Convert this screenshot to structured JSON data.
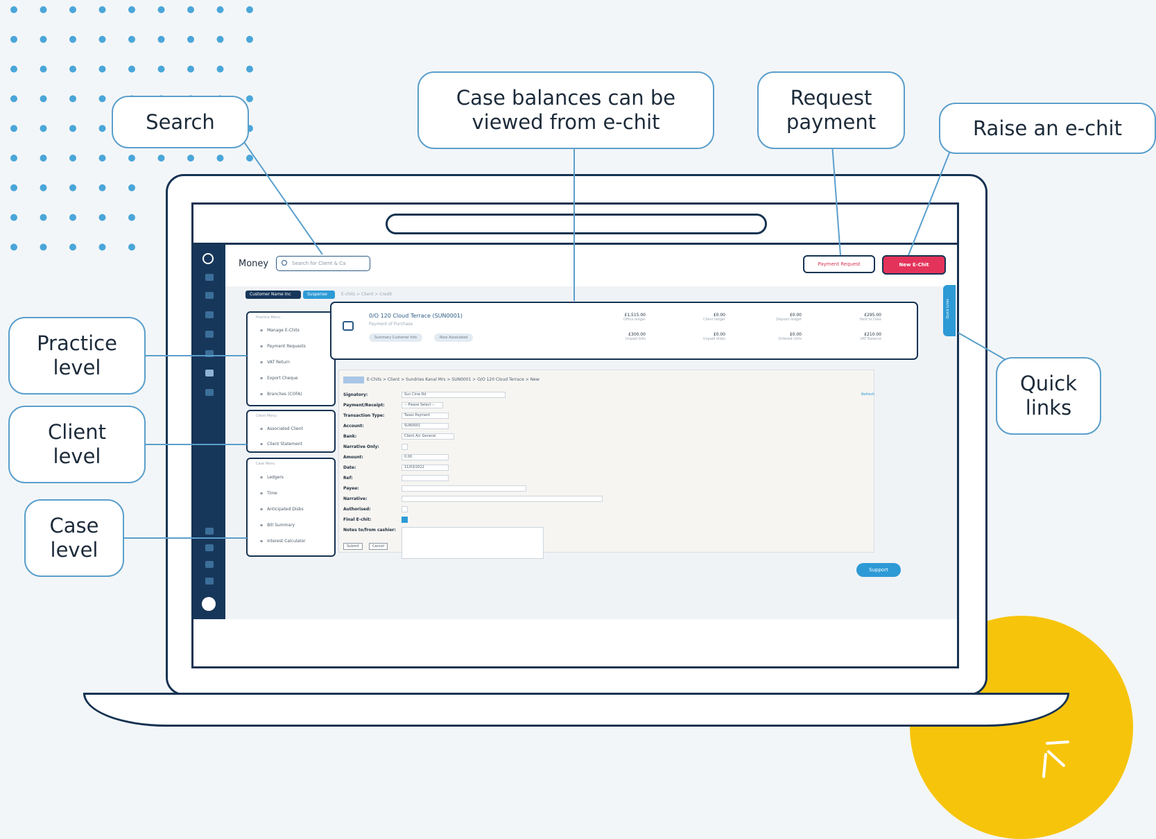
{
  "callouts": {
    "search": "Search",
    "case_balances": "Case balances can be viewed from e-chit",
    "request_payment": "Request payment",
    "raise_echit": "Raise an e-chit",
    "practice_level": "Practice level",
    "client_level": "Client level",
    "case_level": "Case level",
    "quick_links": "Quick links"
  },
  "app": {
    "title": "Money",
    "search_placeholder": "Search for Client & Ca",
    "payment_request_label": "Payment Request",
    "new_echit_label": "New E-Chit",
    "filter_tags": [
      "Customer Name Inc",
      "Suspense"
    ],
    "breadcrumb": "E-chits > Client > Credit",
    "practice_menu": {
      "header": "Practice Menu",
      "items": [
        "Manage E-Chits",
        "Payment Requests",
        "VAT Return",
        "Export Cheque",
        "Branches (COFA)"
      ]
    },
    "client_menu": {
      "header": "Client Menu",
      "items": [
        "Associated Client",
        "Client Statement"
      ]
    },
    "case_menu": {
      "header": "Case Menu",
      "items": [
        "Ledgers",
        "Time",
        "Anticipated Disbs",
        "Bill Summary",
        "Interest Calculator"
      ]
    },
    "case_card": {
      "name": "0/O 120 Cloud Terrace (SUN0001)",
      "subtitle": "Payment of Purchase",
      "pills": [
        "Summary Customer Info",
        "Ross Associated"
      ],
      "balances": [
        {
          "value": "£1,515.00",
          "label": "Office ledger"
        },
        {
          "value": "£0.00",
          "label": "Client ledger"
        },
        {
          "value": "£0.00",
          "label": "Deposit ledger"
        },
        {
          "value": "£295.00",
          "label": "Held to Date"
        },
        {
          "value": "£300.00",
          "label": "Unpaid bills"
        },
        {
          "value": "£0.00",
          "label": "Unpaid disbs"
        },
        {
          "value": "£0.00",
          "label": "Ordered chits"
        },
        {
          "value": "£210.00",
          "label": "VAT Balance"
        }
      ]
    },
    "quick_links_tab": "Quick Links",
    "form": {
      "header": "E-Chits > Client > Sundries Kanal Mrs > SUN0001 > O/O 120 Cloud Terrace > New",
      "fields": [
        {
          "label": "Signatory:",
          "value": "Sun Cinw Rd"
        },
        {
          "label": "Payment/Receipt:",
          "value": "-- Please Select --"
        },
        {
          "label": "Transaction Type:",
          "value": "Taxes Payment"
        },
        {
          "label": "Account:",
          "value": "SUN0001"
        },
        {
          "label": "Bank:",
          "value": "Client A/c General"
        },
        {
          "label": "Narrative Only:",
          "value": ""
        },
        {
          "label": "Amount:",
          "value": "0.00"
        },
        {
          "label": "Date:",
          "value": "11/03/2022"
        },
        {
          "label": "Ref:",
          "value": ""
        },
        {
          "label": "Payee:",
          "value": ""
        },
        {
          "label": "Narrative:",
          "value": ""
        },
        {
          "label": "Authorised:",
          "value": ""
        },
        {
          "label": "Final E-chit:",
          "value": ""
        },
        {
          "label": "Notes to/from cashier:",
          "value": ""
        }
      ],
      "submit_label": "Submit",
      "cancel_label": "Cancel",
      "refresh_label": "Refresh"
    },
    "support_label": "Support"
  },
  "colors": {
    "accent": "#2d9ad6",
    "navy": "#17375a",
    "cta": "#e4335a",
    "yellow": "#f7c40c",
    "callout_border": "#5a9fcc"
  }
}
